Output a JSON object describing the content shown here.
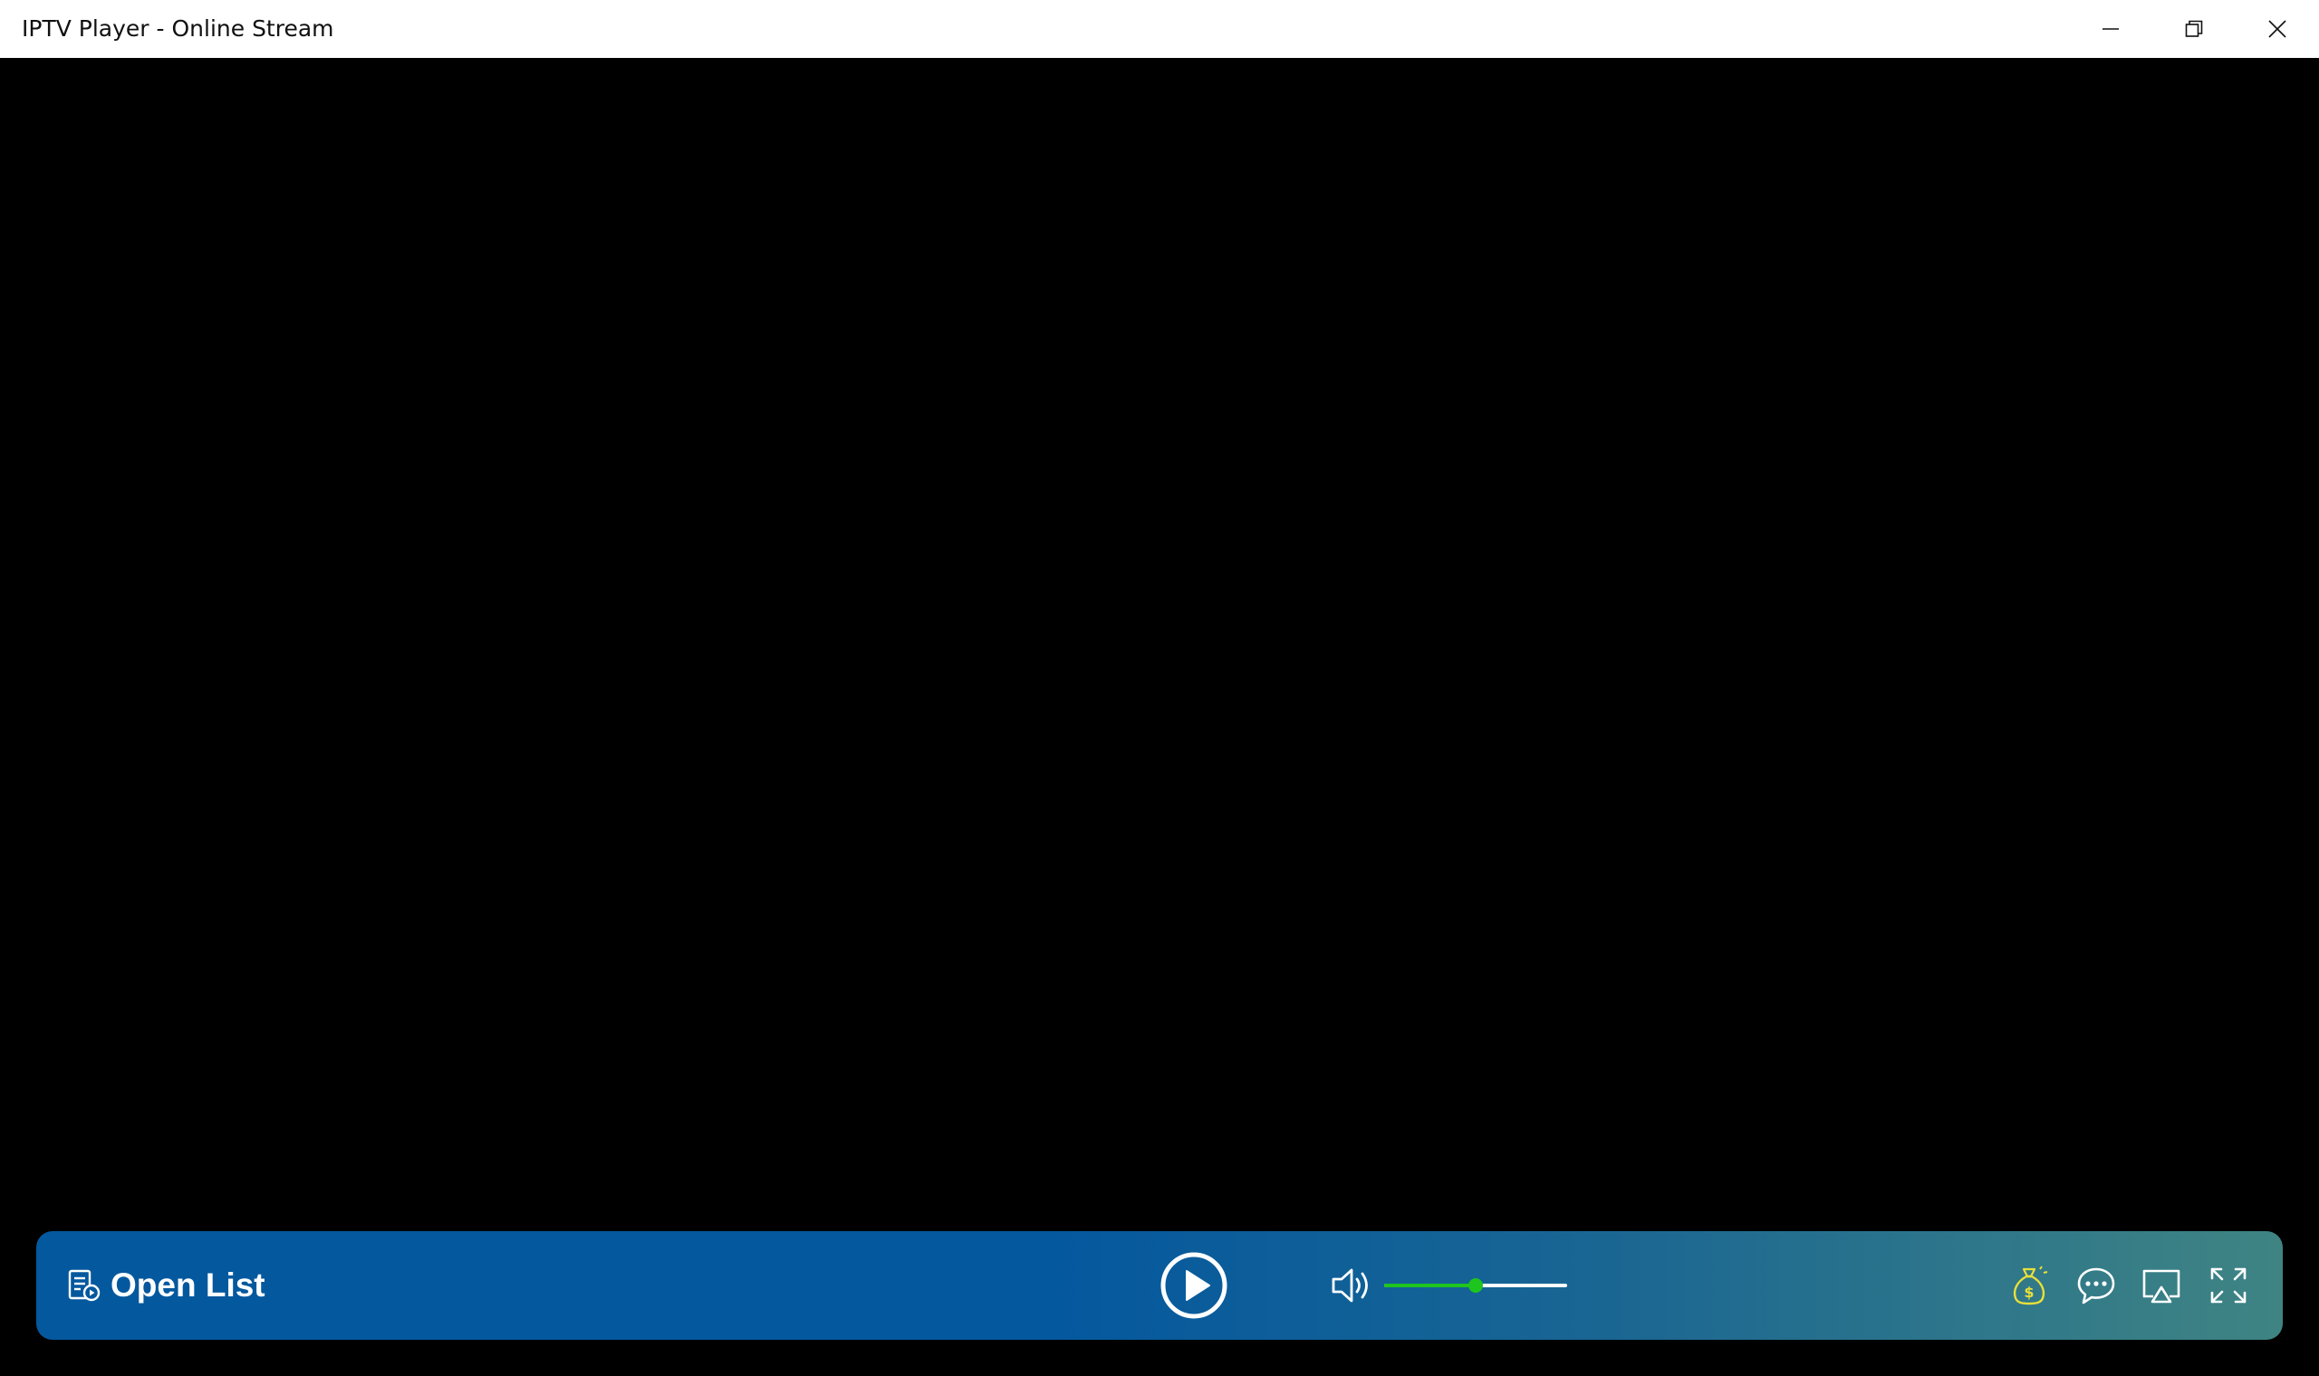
{
  "window": {
    "title": "IPTV Player - Online Stream",
    "controls": {
      "minimize_icon": "minimize-icon",
      "restore_icon": "restore-icon",
      "close_icon": "close-icon"
    }
  },
  "player": {
    "open_list_label": "Open List",
    "open_list_icon": "playlist-icon",
    "play_icon": "play-circle-icon",
    "volume_icon": "speaker-icon",
    "volume_level": 0.5,
    "right_icons": [
      "money-bag-icon",
      "chat-icon",
      "cast-icon",
      "fullscreen-icon"
    ]
  },
  "colors": {
    "bar_left": "#04589e",
    "bar_right": "#3f8483",
    "volume_accent": "#1ec51e",
    "money_icon": "#e8e03a"
  }
}
